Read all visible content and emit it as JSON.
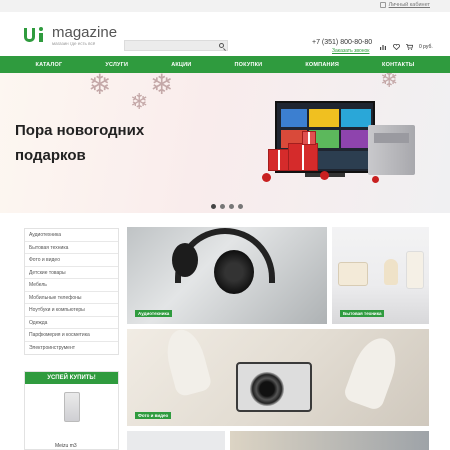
{
  "topbar": {
    "cabinet_label": "Личный кабинет"
  },
  "header": {
    "logo_name": "magazine",
    "logo_tagline": "магазин где есть всё",
    "search_placeholder": "",
    "phone": "+7 (351) 800-80-80",
    "callback_label": "Заказать звонок",
    "cart_total": "0 руб."
  },
  "nav": {
    "items": [
      "КАТАЛОГ",
      "УСЛУГИ",
      "АКЦИИ",
      "ПОКУПКИ",
      "КОМПАНИЯ",
      "КОНТАКТЫ"
    ]
  },
  "hero": {
    "title": "Пора новогодних\nподарков",
    "slides_count": 4,
    "active_slide": 1
  },
  "sidebar": {
    "items": [
      "Аудиотехника",
      "Бытовая техника",
      "Фото и видео",
      "Детские товары",
      "Мебель",
      "Мобильные телефоны",
      "Ноутбуки и компьютеры",
      "Одежда",
      "Парфюмерия и косметика",
      "Электроинструмент"
    ]
  },
  "promo": {
    "title": "УСПЕЙ КУПИТЬ!",
    "product_name": "Meizu m3"
  },
  "tiles": {
    "audio": "Аудиотехника",
    "appliances": "Бытовая техника",
    "photo": "Фото и видео"
  },
  "colors": {
    "accent": "#2f9b3e",
    "label_bg": "#2f9b3e"
  }
}
